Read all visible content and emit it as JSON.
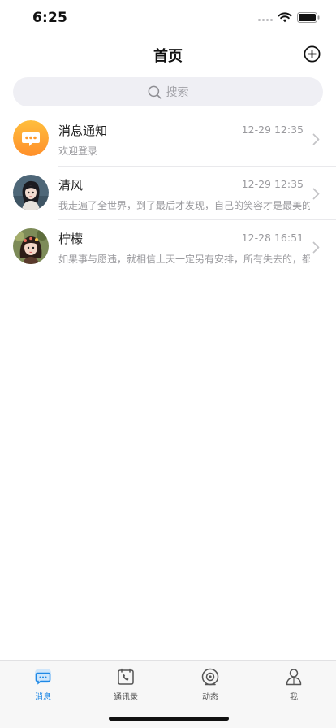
{
  "status_bar": {
    "time": "6:25"
  },
  "nav": {
    "title": "首页",
    "add_icon": "plus-circle-icon"
  },
  "search": {
    "placeholder": "搜索",
    "icon": "search-icon"
  },
  "chats": [
    {
      "name": "消息通知",
      "time": "12-29 12:35",
      "preview": "欢迎登录",
      "avatar": "notification-bubble-icon"
    },
    {
      "name": "清风",
      "time": "12-29 12:35",
      "preview": "我走遍了全世界，到了最后才发现，自己的笑容才是最美的",
      "avatar": "user-avatar"
    },
    {
      "name": "柠檬",
      "time": "12-28 16:51",
      "preview": "如果事与愿违，就相信上天一定另有安排，所有失去的，都会",
      "avatar": "user-avatar"
    }
  ],
  "tabs": [
    {
      "label": "消息",
      "icon": "message-icon",
      "active": true
    },
    {
      "label": "通讯录",
      "icon": "contacts-icon",
      "active": false
    },
    {
      "label": "动态",
      "icon": "moments-icon",
      "active": false
    },
    {
      "label": "我",
      "icon": "profile-icon",
      "active": false
    }
  ],
  "colors": {
    "accent": "#1e88e5",
    "notification_avatar": "#ffa533"
  }
}
